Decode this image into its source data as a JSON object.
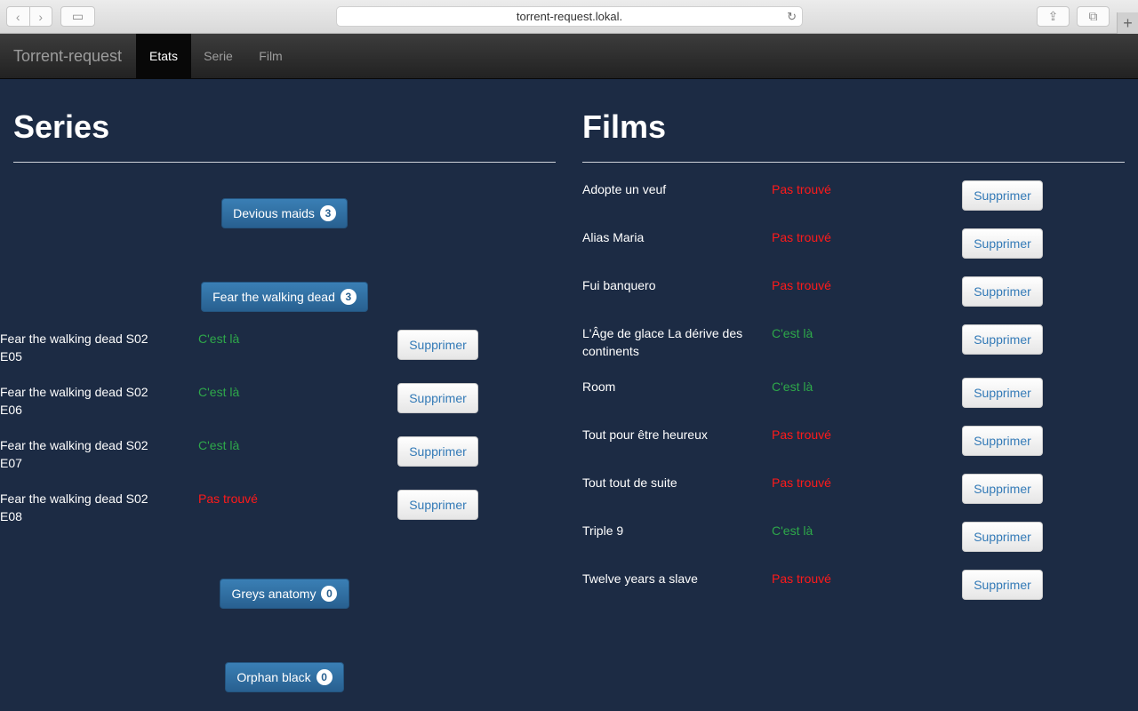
{
  "browser": {
    "url": "torrent-request.lokal."
  },
  "navbar": {
    "brand": "Torrent-request",
    "items": [
      {
        "label": "Etats",
        "active": true
      },
      {
        "label": "Serie",
        "active": false
      },
      {
        "label": "Film",
        "active": false
      }
    ]
  },
  "series": {
    "heading": "Series",
    "groups": [
      {
        "label": "Devious maids",
        "count": "3"
      },
      {
        "label": "Fear the walking dead",
        "count": "3"
      },
      {
        "label": "Greys anatomy",
        "count": "0"
      },
      {
        "label": "Orphan black",
        "count": "0"
      }
    ],
    "episodes": [
      {
        "line1": "Fear the walking dead S02",
        "line2": "E05",
        "status": "C'est là",
        "ok": true
      },
      {
        "line1": "Fear the walking dead S02",
        "line2": "E06",
        "status": "C'est là",
        "ok": true
      },
      {
        "line1": "Fear the walking dead S02",
        "line2": "E07",
        "status": "C'est là",
        "ok": true
      },
      {
        "line1": "Fear the walking dead S02",
        "line2": "E08",
        "status": "Pas trouvé",
        "ok": false
      }
    ],
    "delete_label": "Supprimer"
  },
  "films": {
    "heading": "Films",
    "items": [
      {
        "line1": "Adopte un veuf",
        "line2": "",
        "status": "Pas trouvé",
        "ok": false
      },
      {
        "line1": "Alias Maria",
        "line2": "",
        "status": "Pas trouvé",
        "ok": false
      },
      {
        "line1": "Fui banquero",
        "line2": "",
        "status": "Pas trouvé",
        "ok": false
      },
      {
        "line1": "L'Âge de glace La dérive des",
        "line2": "continents",
        "status": "C'est là",
        "ok": true
      },
      {
        "line1": "Room",
        "line2": "",
        "status": "C'est là",
        "ok": true
      },
      {
        "line1": "Tout pour être heureux",
        "line2": "",
        "status": "Pas trouvé",
        "ok": false
      },
      {
        "line1": "Tout tout de suite",
        "line2": "",
        "status": "Pas trouvé",
        "ok": false
      },
      {
        "line1": "Triple 9",
        "line2": "",
        "status": "C'est là",
        "ok": true
      },
      {
        "line1": "Twelve years a slave",
        "line2": "",
        "status": "Pas trouvé",
        "ok": false
      }
    ],
    "delete_label": "Supprimer"
  },
  "colors": {
    "background": "#1c2b44",
    "ok": "#2ea84a",
    "ko": "#ff1a1a",
    "primary": "#286090"
  }
}
